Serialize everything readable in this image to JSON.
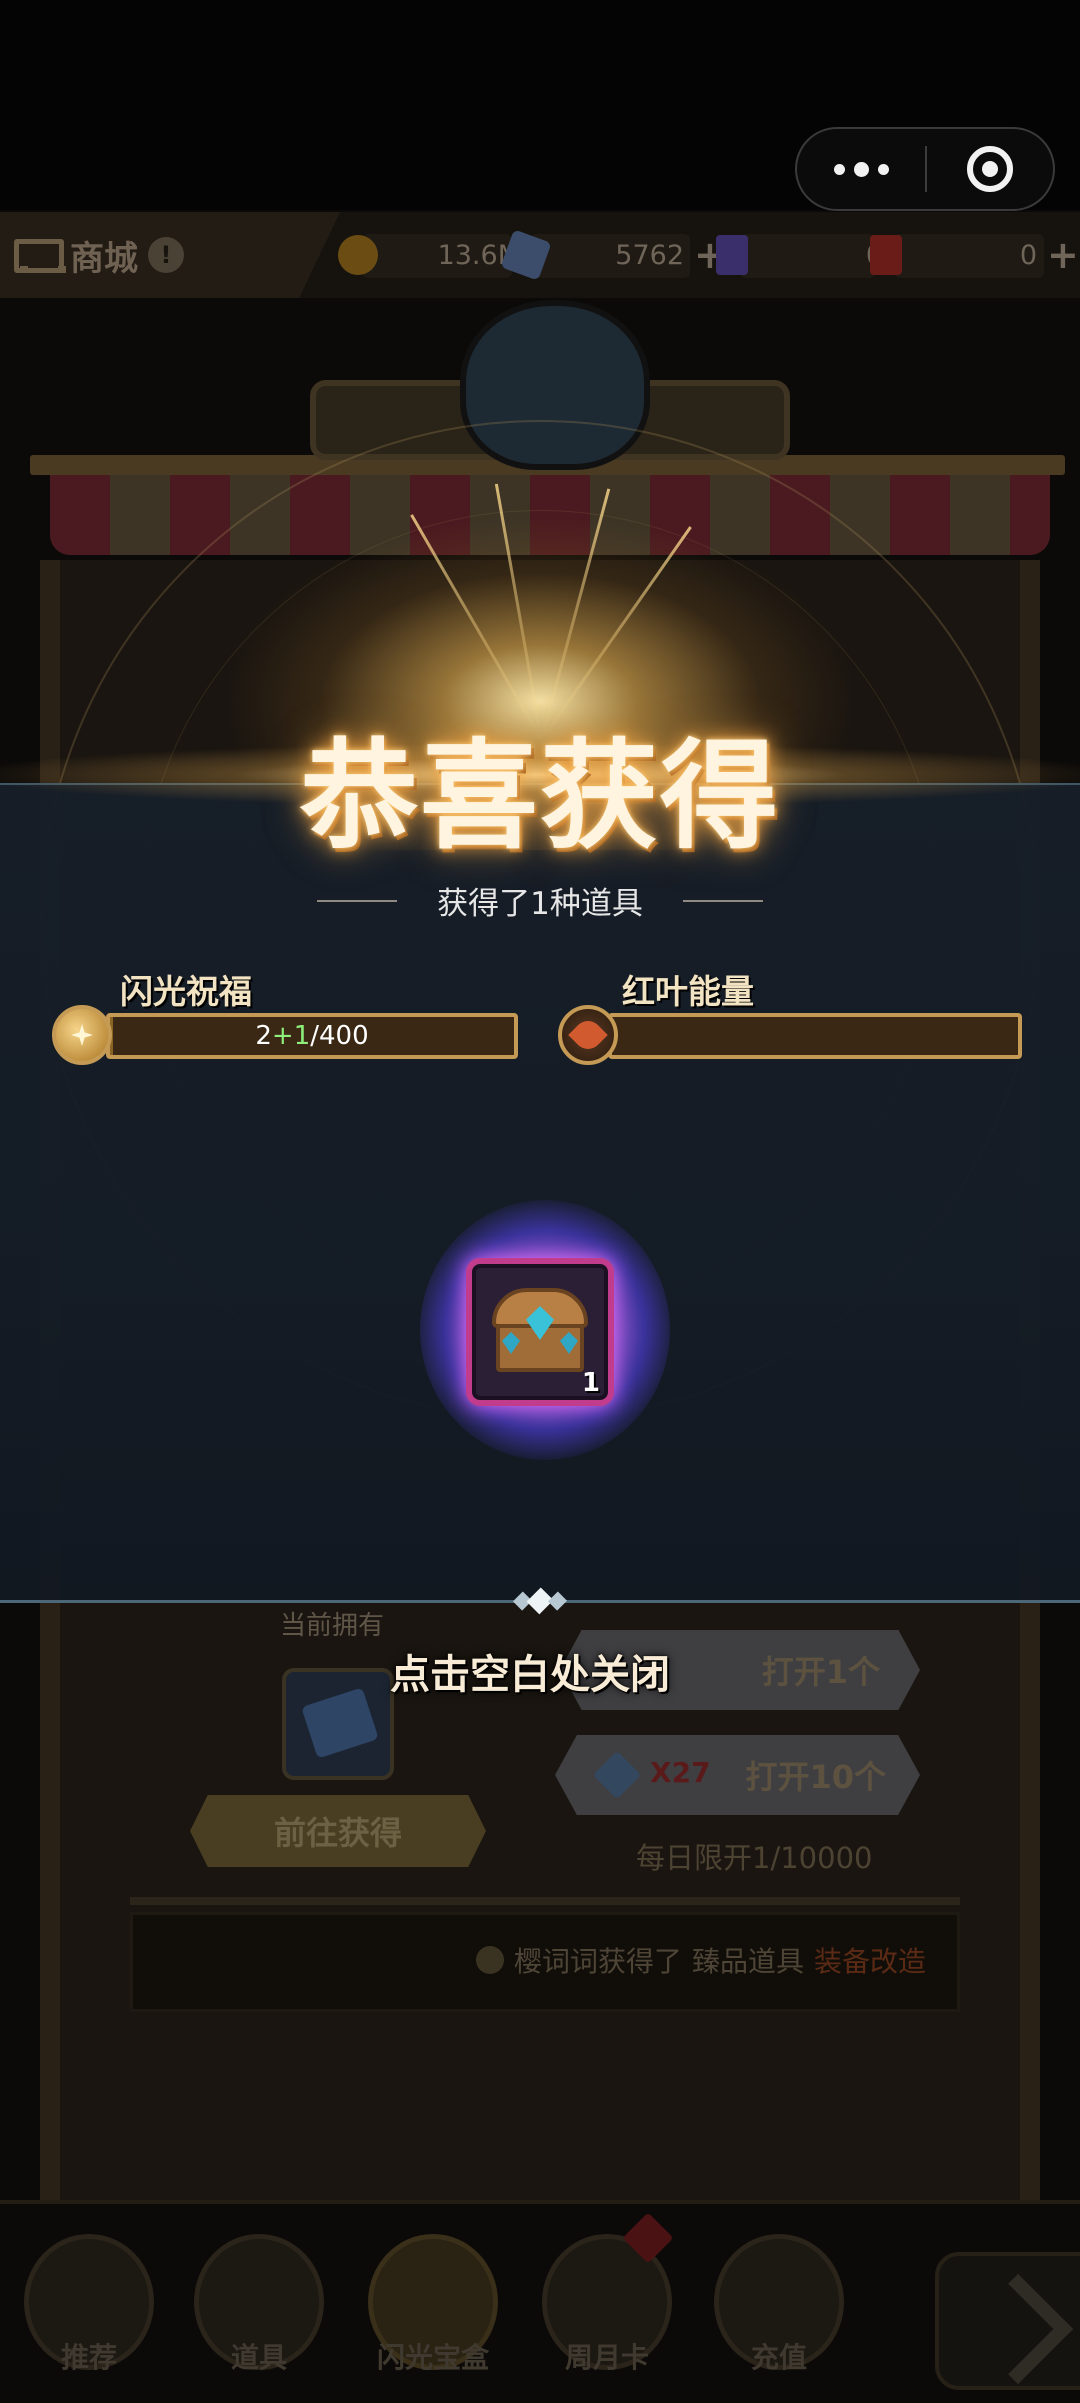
{
  "topbar": {
    "shop_label": "商城",
    "currencies": [
      {
        "icon": "gold-coin-icon",
        "value": "13.6M",
        "has_plus": false
      },
      {
        "icon": "gem-icon",
        "value": "5762",
        "has_plus": true
      },
      {
        "icon": "ticket-icon",
        "value": "0",
        "has_plus": false
      },
      {
        "icon": "gold-card-icon",
        "value": "0",
        "has_plus": true
      }
    ],
    "plus_symbol": "+"
  },
  "shop": {
    "owned_label": "当前拥有",
    "go_get_label": "前往获得",
    "open_one_label": "打开1个",
    "open_ten_label": "打开10个",
    "open_ten_cost": "X27",
    "daily_limit": "每日限开1/10000",
    "news": {
      "user": "樱词词获得了",
      "quality": "臻品道具",
      "item": "装备改造"
    }
  },
  "popup": {
    "title": "恭喜获得",
    "subtitle": "获得了1种道具",
    "bars": [
      {
        "label": "闪光祝福",
        "icon": "flash-blessing-icon",
        "current": "2",
        "gain": "+1",
        "max": "/400",
        "progress": 0.0075
      },
      {
        "label": "红叶能量",
        "icon": "red-leaf-icon",
        "progress": 0
      }
    ],
    "reward": {
      "icon": "treasure-chest-icon",
      "rarity_color": "#c13c8c",
      "count": "1"
    },
    "close_hint": "点击空白处关闭"
  },
  "bottom_nav": [
    {
      "label": "推荐",
      "active": false
    },
    {
      "label": "道具",
      "active": false
    },
    {
      "label": "闪光宝盒",
      "active": true
    },
    {
      "label": "周月卡",
      "active": false,
      "badge": "!"
    },
    {
      "label": "充值",
      "active": false
    }
  ],
  "colors": {
    "accent_gold": "#c49a55",
    "title_glow": "#f0a040",
    "gain_green": "#8ef07a"
  }
}
